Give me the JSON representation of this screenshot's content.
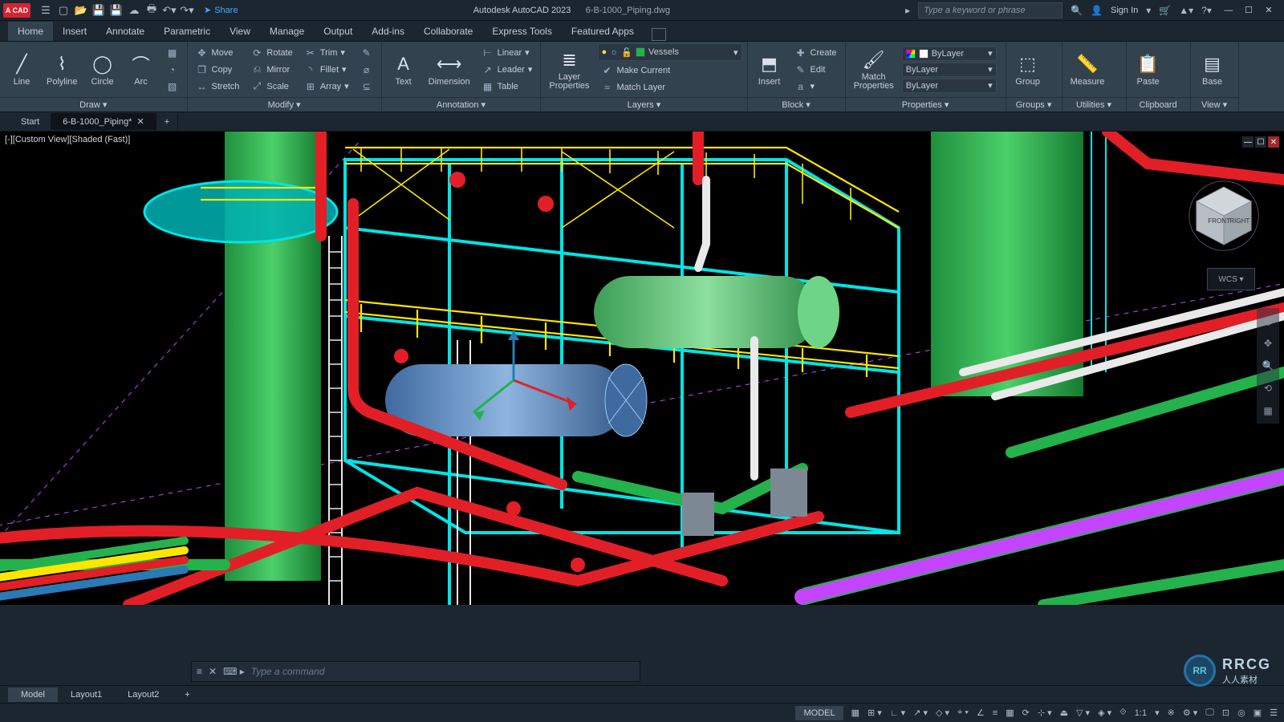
{
  "title": {
    "app": "Autodesk AutoCAD 2023",
    "file": "6-B-1000_Piping.dwg",
    "share": "Share"
  },
  "search": {
    "placeholder": "Type a keyword or phrase",
    "signin": "Sign In"
  },
  "menus": [
    "Home",
    "Insert",
    "Annotate",
    "Parametric",
    "View",
    "Manage",
    "Output",
    "Add-ins",
    "Collaborate",
    "Express Tools",
    "Featured Apps"
  ],
  "active_menu": "Home",
  "doctabs": {
    "items": [
      "Start",
      "6-B-1000_Piping*"
    ],
    "active": 1
  },
  "viewport": {
    "label": "[-][Custom View][Shaded (Fast)]",
    "wcs": "WCS ▾",
    "cube_front": "FRONT",
    "cube_right": "RIGHT"
  },
  "ribbon": {
    "draw": {
      "title": "Draw ▾",
      "items": [
        "Line",
        "Polyline",
        "Circle",
        "Arc"
      ]
    },
    "modify": {
      "title": "Modify ▾",
      "col1": [
        "Move",
        "Copy",
        "Stretch"
      ],
      "col2": [
        "Rotate",
        "Mirror",
        "Scale"
      ],
      "col3": [
        "Trim",
        "Fillet",
        "Array"
      ]
    },
    "annotation": {
      "title": "Annotation ▾",
      "big": [
        "Text",
        "Dimension"
      ],
      "col": [
        "Linear",
        "Leader",
        "Table"
      ]
    },
    "layers": {
      "title": "Layers ▾",
      "big": "Layer\nProperties",
      "selected": "Vessels",
      "col": [
        "Make Current",
        "Match Layer"
      ]
    },
    "block": {
      "title": "Block ▾",
      "big": "Insert",
      "col": [
        "Create",
        "Edit",
        "Edit Attributes"
      ]
    },
    "properties": {
      "title": "Properties ▾",
      "big": "Match\nProperties",
      "rows": [
        "ByLayer",
        "ByLayer",
        "ByLayer"
      ]
    },
    "groups": {
      "title": "Groups ▾",
      "big": "Group"
    },
    "utilities": {
      "title": "Utilities ▾",
      "big": "Measure"
    },
    "clipboard": {
      "title": "Clipboard",
      "big": "Paste"
    },
    "view": {
      "title": "View ▾",
      "big": "Base"
    }
  },
  "cmd": {
    "prompt": "Type a command"
  },
  "layouts": {
    "items": [
      "Model",
      "Layout1",
      "Layout2"
    ],
    "active": 0
  },
  "status": {
    "model": "MODEL",
    "scale": "1:1"
  },
  "colors": {
    "pipe_red": "#e21f26",
    "pipe_green": "#24b24c",
    "pipe_magenta": "#c445ff",
    "steel_cyan": "#00e5e5",
    "rail_yellow": "#ffe600",
    "vessel_green": "#4fb86b",
    "vessel_blue": "#5b8fc7",
    "pipe_white": "#e9e9e9"
  },
  "watermark": {
    "badge": "RR",
    "line1": "RRCG",
    "line2": "人人素材"
  }
}
